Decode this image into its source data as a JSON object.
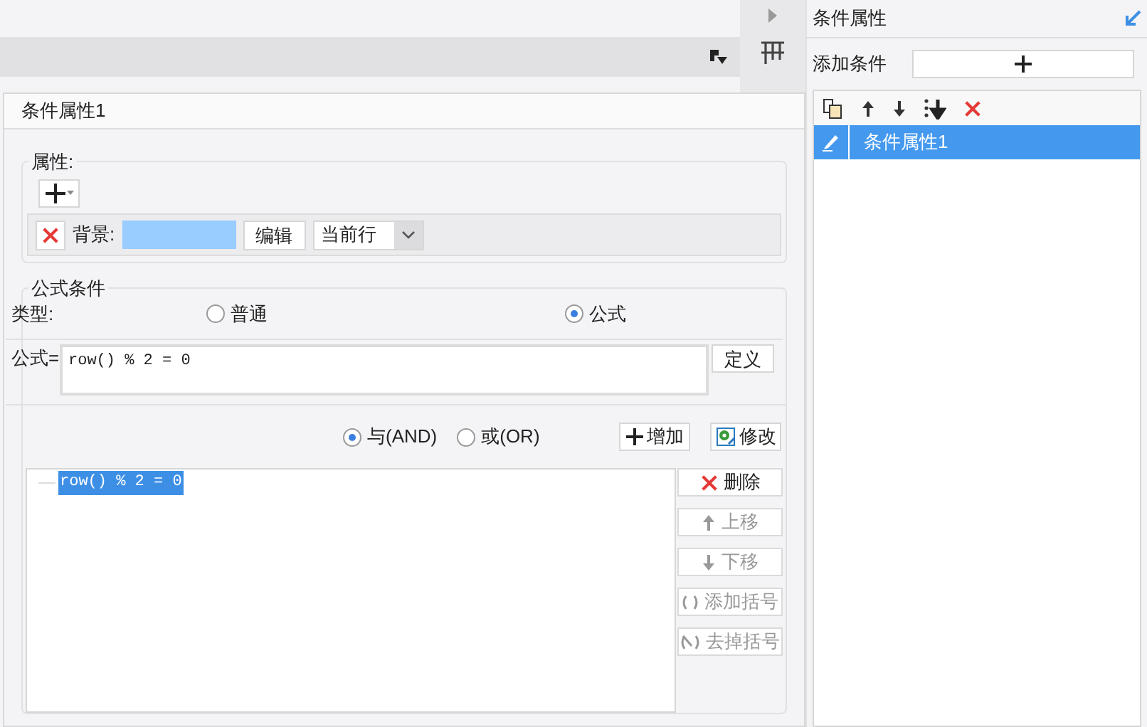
{
  "dialog": {
    "title": "条件属性1",
    "attributes": {
      "legend": "属性:",
      "rows": [
        {
          "label": "背景:",
          "color": "#99ccff",
          "edit_button": "编辑",
          "scope": "当前行"
        }
      ]
    },
    "formula_condition": {
      "legend": "公式条件",
      "type_label": "类型:",
      "types": [
        {
          "label": "普通",
          "selected": false
        },
        {
          "label": "公式",
          "selected": true
        }
      ],
      "formula_label": "公式=",
      "formula": "row() % 2 = 0",
      "define_button": "定义",
      "logic": [
        {
          "label": "与(AND)",
          "selected": true
        },
        {
          "label": "或(OR)",
          "selected": false
        }
      ],
      "add_button": "增加",
      "modify_button": "修改",
      "conditions": [
        {
          "text": "row() % 2 = 0",
          "selected": true
        }
      ],
      "actions": [
        {
          "label": "删除",
          "kind": "delete",
          "disabled": false
        },
        {
          "label": "上移",
          "kind": "up",
          "disabled": true
        },
        {
          "label": "下移",
          "kind": "down",
          "disabled": true
        },
        {
          "label": "添加括号",
          "kind": "add-bracket",
          "disabled": true
        },
        {
          "label": "去掉括号",
          "kind": "remove-bracket",
          "disabled": true
        }
      ]
    }
  },
  "side_panel": {
    "title": "条件属性",
    "add_label": "添加条件",
    "items": [
      {
        "label": "条件属性1",
        "selected": true
      }
    ]
  }
}
